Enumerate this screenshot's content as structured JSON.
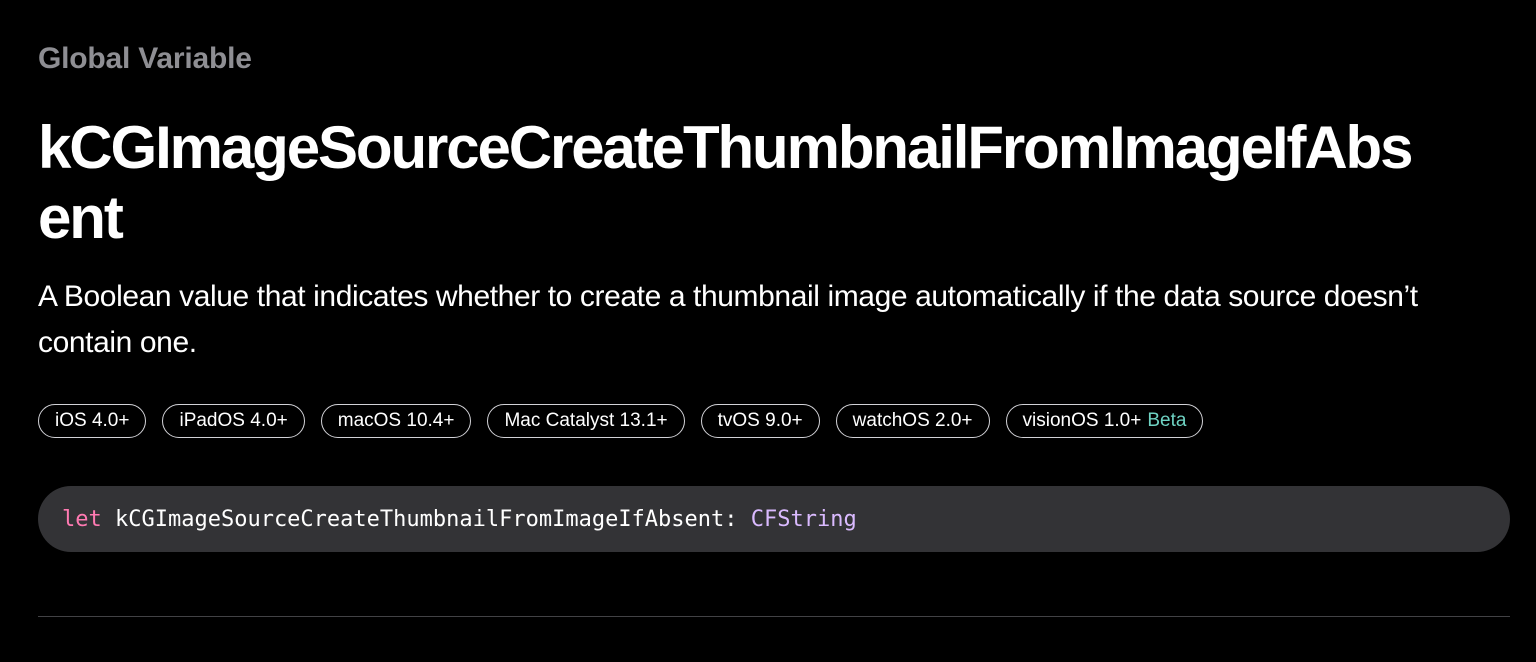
{
  "page": {
    "eyebrow": "Global Variable",
    "title": "kCGImageSourceCreateThumbnailFromImageIfAbsent",
    "abstract": "A Boolean value that indicates whether to create a thumbnail image automatically if the data source doesn’t contain one."
  },
  "platforms": [
    {
      "label": "iOS 4.0+"
    },
    {
      "label": "iPadOS 4.0+"
    },
    {
      "label": "macOS 10.4+"
    },
    {
      "label": "Mac Catalyst 13.1+"
    },
    {
      "label": "tvOS 9.0+"
    },
    {
      "label": "watchOS 2.0+"
    },
    {
      "label": "visionOS 1.0+",
      "badge": "Beta"
    }
  ],
  "declaration": {
    "keyword": "let",
    "name": "kCGImageSourceCreateThumbnailFromImageIfAbsent",
    "colon": ":",
    "type": "CFString"
  },
  "colors": {
    "background": "#000000",
    "eyebrow": "#8e8e93",
    "keyword": "#ff7ab2",
    "type": "#dabaff",
    "beta": "#6ed2c2",
    "code_background": "#333336"
  }
}
